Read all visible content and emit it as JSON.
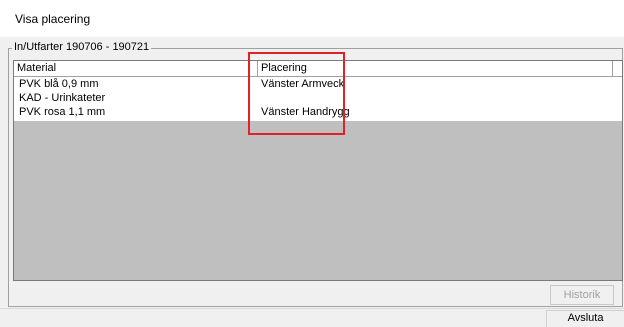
{
  "window": {
    "title": "Visa placering"
  },
  "group": {
    "label": "In/Utfarter 190706 - 190721"
  },
  "table": {
    "columns": [
      "Material",
      "Placering"
    ],
    "rows": [
      {
        "material": "PVK blå 0,9 mm",
        "placering": "Vänster Armveck"
      },
      {
        "material": "KAD - Urinkateter",
        "placering": ""
      },
      {
        "material": "PVK rosa 1,1 mm",
        "placering": "Vänster Handrygg"
      }
    ]
  },
  "buttons": {
    "historik": "Historik",
    "avsluta": "Avsluta"
  },
  "colors": {
    "highlight": "#e0202a",
    "list_empty_area": "#bfbfbf"
  }
}
